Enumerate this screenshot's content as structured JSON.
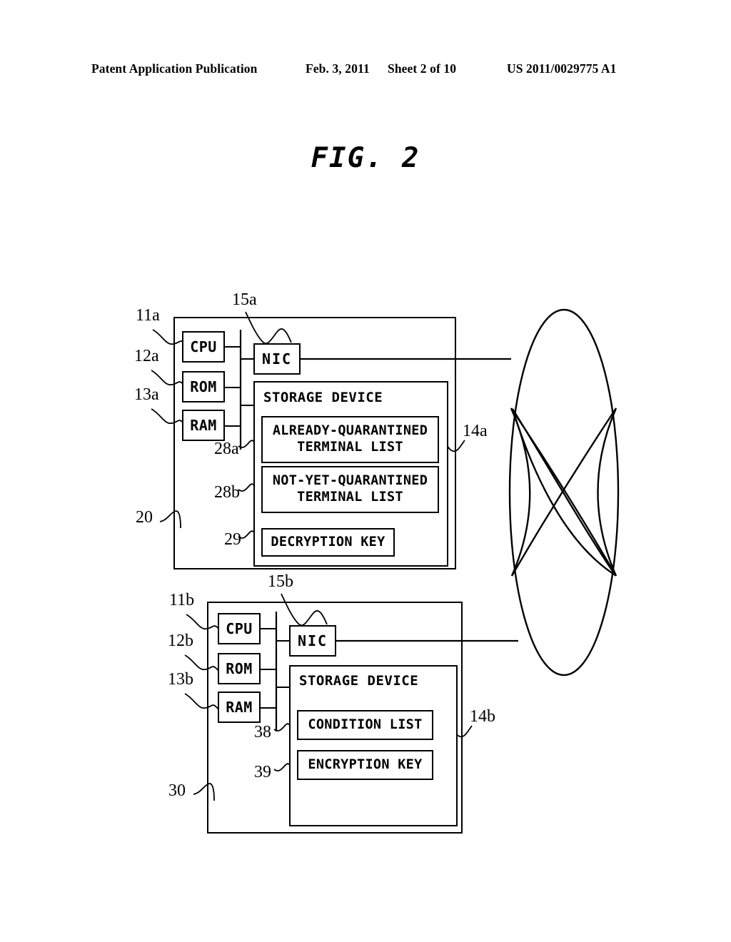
{
  "header": {
    "publication": "Patent Application Publication",
    "date": "Feb. 3, 2011",
    "sheet": "Sheet 2 of 10",
    "doc_number": "US 2011/0029775 A1"
  },
  "figure": {
    "title": "FIG. 2"
  },
  "diagram": {
    "upper_apparatus": {
      "ref": "20",
      "units": [
        {
          "ref": "11a",
          "label": "CPU"
        },
        {
          "ref": "12a",
          "label": "ROM"
        },
        {
          "ref": "13a",
          "label": "RAM"
        }
      ],
      "nic": {
        "ref": "15a",
        "label": "NIC"
      },
      "storage": {
        "ref": "14a",
        "label": "STORAGE DEVICE",
        "items": [
          {
            "ref": "28a",
            "line1": "ALREADY-QUARANTINED",
            "line2": "TERMINAL LIST"
          },
          {
            "ref": "28b",
            "line1": "NOT-YET-QUARANTINED",
            "line2": "TERMINAL LIST"
          },
          {
            "ref": "29",
            "line1": "DECRYPTION KEY",
            "line2": ""
          }
        ]
      }
    },
    "lower_apparatus": {
      "ref": "30",
      "units": [
        {
          "ref": "11b",
          "label": "CPU"
        },
        {
          "ref": "12b",
          "label": "ROM"
        },
        {
          "ref": "13b",
          "label": "RAM"
        }
      ],
      "nic": {
        "ref": "15b",
        "label": "NIC"
      },
      "storage": {
        "ref": "14b",
        "label": "STORAGE DEVICE",
        "items": [
          {
            "ref": "38",
            "line1": "CONDITION LIST",
            "line2": ""
          },
          {
            "ref": "39",
            "line1": "ENCRYPTION KEY",
            "line2": ""
          }
        ]
      }
    },
    "network": {
      "name": "network-cloud-icon"
    },
    "colors": {
      "line": "#000000",
      "background": "#ffffff"
    }
  }
}
